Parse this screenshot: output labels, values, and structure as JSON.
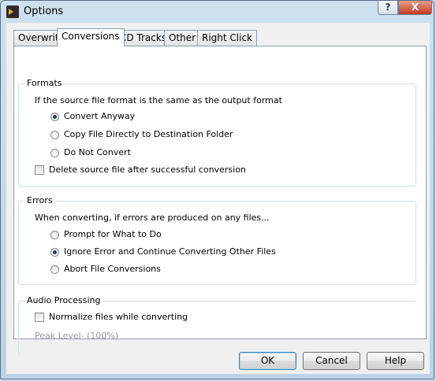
{
  "window": {
    "title": "Options",
    "help_glyph": "?",
    "close_glyph": "X"
  },
  "tabs": [
    {
      "label": "Overwrite"
    },
    {
      "label": "Conversions"
    },
    {
      "label": "CD Tracks"
    },
    {
      "label": "Other"
    },
    {
      "label": "Right Click"
    }
  ],
  "formats": {
    "title": "Formats",
    "description": "If the source file format is the same as the output format",
    "options": [
      {
        "label": "Convert Anyway",
        "checked": true
      },
      {
        "label": "Copy File Directly to Destination Folder",
        "checked": false
      },
      {
        "label": "Do Not Convert",
        "checked": false
      }
    ],
    "delete_source_label": "Delete source file after successful conversion",
    "delete_source_checked": false
  },
  "errors": {
    "title": "Errors",
    "description": "When converting, if errors are produced on any files...",
    "options": [
      {
        "label": "Prompt for What to Do",
        "checked": false
      },
      {
        "label": "Ignore Error and Continue Converting Other Files",
        "checked": true
      },
      {
        "label": "Abort File Conversions",
        "checked": false
      }
    ]
  },
  "audio": {
    "title": "Audio Processing",
    "normalize_label": "Normalize files while converting",
    "normalize_checked": false,
    "peak_level_label": "Peak Level- (100%)"
  },
  "buttons": {
    "ok": "OK",
    "cancel": "Cancel",
    "help": "Help"
  }
}
